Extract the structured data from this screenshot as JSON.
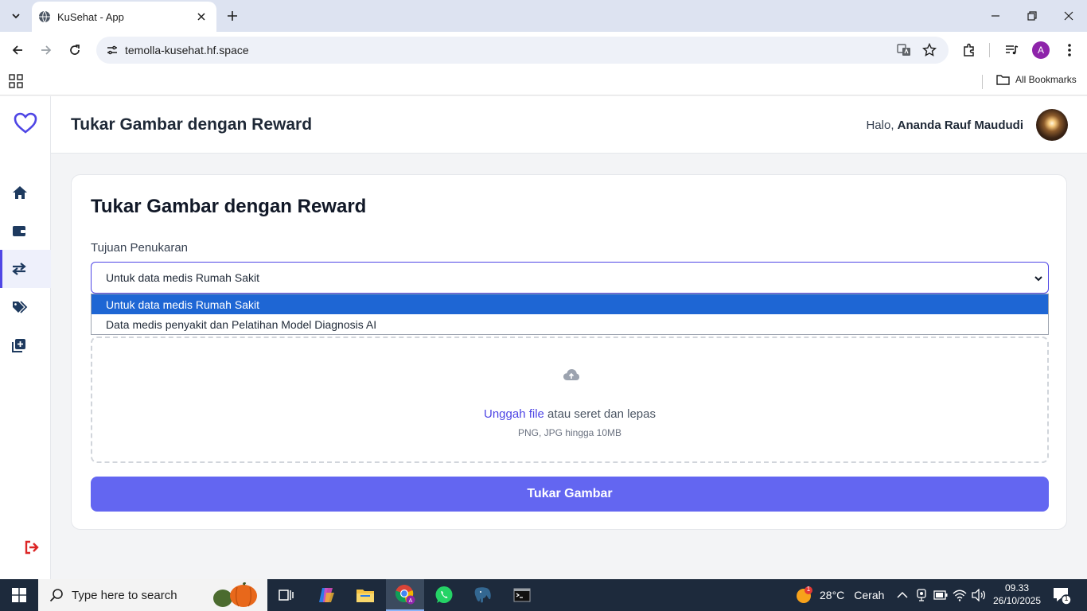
{
  "browser": {
    "tab_title": "KuSehat - App",
    "url": "temolla-kusehat.hf.space",
    "profile_initial": "A",
    "bookmarks_label": "All Bookmarks"
  },
  "app": {
    "header_title": "Tukar Gambar dengan Reward",
    "greeting_prefix": "Halo,",
    "user_name": "Ananda Rauf Maududi",
    "sidebar": [
      {
        "name": "home-icon",
        "active": false
      },
      {
        "name": "wallet-icon",
        "active": false
      },
      {
        "name": "exchange-icon",
        "active": true
      },
      {
        "name": "tags-icon",
        "active": false
      },
      {
        "name": "add-photo-icon",
        "active": false
      }
    ],
    "colors": {
      "accent": "#6366f1",
      "accent_dark": "#4f46e5",
      "option_highlight": "#1e66d4"
    }
  },
  "form": {
    "title": "Tukar Gambar dengan Reward",
    "purpose_label": "Tujuan Penukaran",
    "purpose_selected": "Untuk data medis Rumah Sakit",
    "purpose_options": [
      "Untuk data medis Rumah Sakit",
      "Data medis penyakit dan Pelatihan Model Diagnosis AI"
    ],
    "upload_link": "Unggah file",
    "upload_text": " atau seret dan lepas",
    "upload_hint": "PNG, JPG hingga 10MB",
    "submit_label": "Tukar Gambar"
  },
  "taskbar": {
    "search_placeholder": "Type here to search",
    "weather_temp": "28°C",
    "weather_desc": "Cerah",
    "weather_badge": "1",
    "time": "09.33",
    "date": "26/10/2025",
    "notification_count": "1"
  }
}
